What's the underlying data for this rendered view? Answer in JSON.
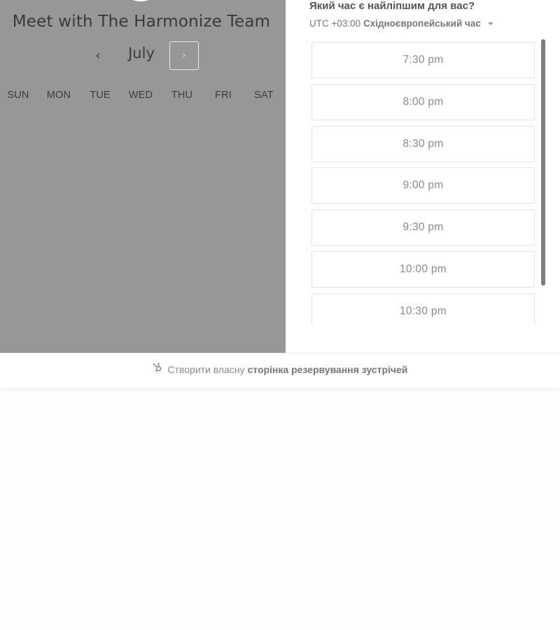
{
  "meeting": {
    "title": "Meet with The Harmonize Team"
  },
  "calendar": {
    "prev_icon": "‹",
    "next_icon": "›",
    "month": "July",
    "weekdays": [
      "SUN",
      "MON",
      "TUE",
      "WED",
      "THU",
      "FRI",
      "SAT"
    ]
  },
  "times": {
    "question": "Який час є найліпшим для вас?",
    "timezone_offset": "UTC +03:00",
    "timezone_name": "Східноєвропейський час",
    "slots": [
      "7:30 pm",
      "8:00 pm",
      "8:30 pm",
      "9:00 pm",
      "9:30 pm",
      "10:00 pm",
      "10:30 pm"
    ]
  },
  "footer": {
    "prefix": "Створити власну",
    "link": "сторінка резервування зустрічей",
    "icon": "hubspot-sprocket-icon"
  }
}
